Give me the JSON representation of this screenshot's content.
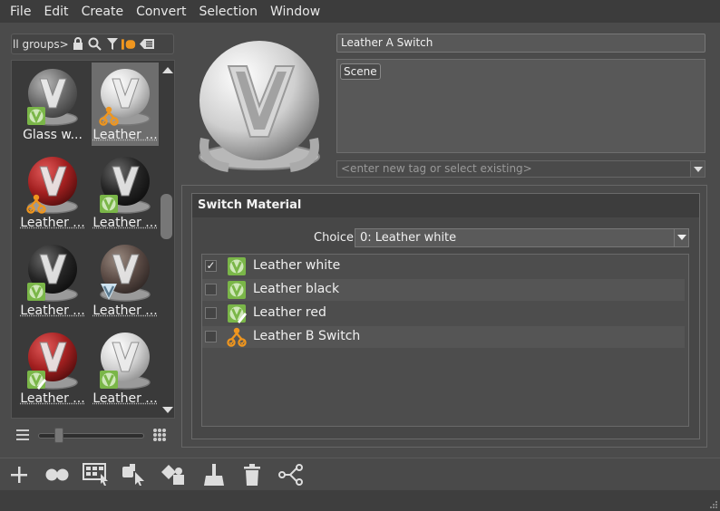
{
  "menubar": {
    "items": [
      "File",
      "Edit",
      "Create",
      "Convert",
      "Selection",
      "Window"
    ]
  },
  "groups": {
    "filter_label": "ll groups>",
    "icons": [
      "lock-icon",
      "search-icon",
      "filter-icon",
      "tag-icon",
      "list-icon"
    ]
  },
  "library": {
    "items": [
      {
        "label": "Glass w...",
        "sphere": "dark-gray",
        "badge": "vred-material",
        "selected": false
      },
      {
        "label": "Leather ...",
        "sphere": "white",
        "badge": "switch",
        "selected": true
      },
      {
        "label": "Leather ...",
        "sphere": "red",
        "badge": "switch",
        "selected": false
      },
      {
        "label": "Leather ...",
        "sphere": "black",
        "badge": "vred-material",
        "selected": false
      },
      {
        "label": "Leather ...",
        "sphere": "black",
        "badge": "vred-material",
        "selected": false
      },
      {
        "label": "Leather ...",
        "sphere": "brown",
        "badge": "mixed",
        "selected": false
      },
      {
        "label": "Leather ...",
        "sphere": "red",
        "badge": "vred-material-edit",
        "selected": false
      },
      {
        "label": "Leather ...",
        "sphere": "white",
        "badge": "vred-material",
        "selected": false
      }
    ]
  },
  "details": {
    "name": "Leather A Switch",
    "tags": [
      "Scene"
    ],
    "tag_placeholder": "<enter new tag or select existing>"
  },
  "switch_material": {
    "title": "Switch Material",
    "choice_label": "Choice",
    "choice_value": "0: Leather white",
    "materials": [
      {
        "label": "Leather white",
        "checked": true,
        "icon": "vred-material"
      },
      {
        "label": "Leather black",
        "checked": false,
        "icon": "vred-material"
      },
      {
        "label": "Leather red",
        "checked": false,
        "icon": "vred-material-edit"
      },
      {
        "label": "Leather B Switch",
        "checked": false,
        "icon": "switch"
      }
    ]
  },
  "toolbar": {
    "buttons": [
      "add-icon",
      "dots-icon",
      "grid-select-icon",
      "pick-icon",
      "assign-icon",
      "clean-icon",
      "delete-icon",
      "graph-icon"
    ]
  },
  "colors": {
    "accent_green": "#7ab648",
    "switch_orange": "#f0961e"
  }
}
